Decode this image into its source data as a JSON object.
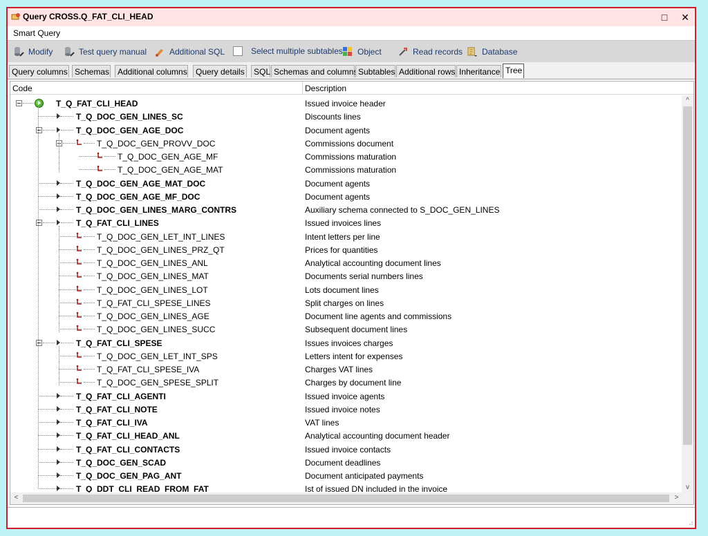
{
  "window": {
    "title": "Query CROSS.Q_FAT_CLI_HEAD",
    "maximize_icon": "□",
    "close_icon": "✕"
  },
  "menu": {
    "smart_query": "Smart Query"
  },
  "toolbar": {
    "modify": "Modify",
    "test_query_manual": "Test query manual",
    "additional_sql": "Additional SQL",
    "select_multiple_subtables": "Select multiple subtables",
    "object": "Object",
    "read_records": "Read records",
    "database": "Database"
  },
  "tabs": [
    {
      "label": "Query columns"
    },
    {
      "label": "Schemas"
    },
    {
      "label": "Additional columns"
    },
    {
      "label": "Query details"
    },
    {
      "label": "SQL"
    },
    {
      "label": "Schemas and columns"
    },
    {
      "label": "Subtables"
    },
    {
      "label": "Additional rows"
    },
    {
      "label": "Inheritance"
    },
    {
      "label": "Tree"
    }
  ],
  "grid": {
    "col_code": "Code",
    "col_description": "Description",
    "rows": [
      {
        "code": "T_Q_FAT_CLI_HEAD",
        "desc": "Issued invoice header",
        "level": 0,
        "bold": true,
        "kind": "root",
        "expanded": true
      },
      {
        "code": "T_Q_DOC_GEN_LINES_SC",
        "desc": "Discounts lines",
        "level": 1,
        "bold": true,
        "kind": "arrow"
      },
      {
        "code": "T_Q_DOC_GEN_AGE_DOC",
        "desc": "Document agents",
        "level": 1,
        "bold": true,
        "kind": "arrow",
        "expanded": true
      },
      {
        "code": "T_Q_DOC_GEN_PROVV_DOC",
        "desc": "Commissions document",
        "level": 2,
        "bold": false,
        "kind": "rel",
        "expanded": true
      },
      {
        "code": "T_Q_DOC_GEN_AGE_MF",
        "desc": "Commissions maturation",
        "level": 3,
        "bold": false,
        "kind": "rel"
      },
      {
        "code": "T_Q_DOC_GEN_AGE_MAT",
        "desc": "Commissions maturation",
        "level": 3,
        "bold": false,
        "kind": "rel"
      },
      {
        "code": "T_Q_DOC_GEN_AGE_MAT_DOC",
        "desc": "Document agents",
        "level": 1,
        "bold": true,
        "kind": "arrow"
      },
      {
        "code": "T_Q_DOC_GEN_AGE_MF_DOC",
        "desc": "Document agents",
        "level": 1,
        "bold": true,
        "kind": "arrow"
      },
      {
        "code": "T_Q_DOC_GEN_LINES_MARG_CONTRS",
        "desc": "Auxiliary schema connected to S_DOC_GEN_LINES",
        "level": 1,
        "bold": true,
        "kind": "arrow"
      },
      {
        "code": "T_Q_FAT_CLI_LINES",
        "desc": "Issued invoices lines",
        "level": 1,
        "bold": true,
        "kind": "arrow",
        "expanded": true
      },
      {
        "code": "T_Q_DOC_GEN_LET_INT_LINES",
        "desc": "Intent letters per line",
        "level": 2,
        "bold": false,
        "kind": "rel"
      },
      {
        "code": "T_Q_DOC_GEN_LINES_PRZ_QT",
        "desc": "Prices for quantities",
        "level": 2,
        "bold": false,
        "kind": "rel"
      },
      {
        "code": "T_Q_DOC_GEN_LINES_ANL",
        "desc": "Analytical accounting document lines",
        "level": 2,
        "bold": false,
        "kind": "rel"
      },
      {
        "code": "T_Q_DOC_GEN_LINES_MAT",
        "desc": "Documents serial numbers lines",
        "level": 2,
        "bold": false,
        "kind": "rel"
      },
      {
        "code": "T_Q_DOC_GEN_LINES_LOT",
        "desc": "Lots document lines",
        "level": 2,
        "bold": false,
        "kind": "rel"
      },
      {
        "code": "T_Q_FAT_CLI_SPESE_LINES",
        "desc": "Split charges on lines",
        "level": 2,
        "bold": false,
        "kind": "rel"
      },
      {
        "code": "T_Q_DOC_GEN_LINES_AGE",
        "desc": "Document line agents and commissions",
        "level": 2,
        "bold": false,
        "kind": "rel"
      },
      {
        "code": "T_Q_DOC_GEN_LINES_SUCC",
        "desc": "Subsequent document lines",
        "level": 2,
        "bold": false,
        "kind": "rel"
      },
      {
        "code": "T_Q_FAT_CLI_SPESE",
        "desc": "Issues invoices charges",
        "level": 1,
        "bold": true,
        "kind": "arrow",
        "expanded": true
      },
      {
        "code": "T_Q_DOC_GEN_LET_INT_SPS",
        "desc": "Letters intent for expenses",
        "level": 2,
        "bold": false,
        "kind": "rel"
      },
      {
        "code": "T_Q_FAT_CLI_SPESE_IVA",
        "desc": "Charges VAT lines",
        "level": 2,
        "bold": false,
        "kind": "rel"
      },
      {
        "code": "T_Q_DOC_GEN_SPESE_SPLIT",
        "desc": "Charges by document line",
        "level": 2,
        "bold": false,
        "kind": "rel"
      },
      {
        "code": "T_Q_FAT_CLI_AGENTI",
        "desc": "Issued invoice agents",
        "level": 1,
        "bold": true,
        "kind": "arrow"
      },
      {
        "code": "T_Q_FAT_CLI_NOTE",
        "desc": "Issued invoice notes",
        "level": 1,
        "bold": true,
        "kind": "arrow"
      },
      {
        "code": "T_Q_FAT_CLI_IVA",
        "desc": "VAT lines",
        "level": 1,
        "bold": true,
        "kind": "arrow"
      },
      {
        "code": "T_Q_FAT_CLI_HEAD_ANL",
        "desc": "Analytical accounting document header",
        "level": 1,
        "bold": true,
        "kind": "arrow"
      },
      {
        "code": "T_Q_FAT_CLI_CONTACTS",
        "desc": "Issued invoice contacts",
        "level": 1,
        "bold": true,
        "kind": "arrow"
      },
      {
        "code": "T_Q_DOC_GEN_SCAD",
        "desc": "Document deadlines",
        "level": 1,
        "bold": true,
        "kind": "arrow"
      },
      {
        "code": "T_Q_DOC_GEN_PAG_ANT",
        "desc": "Document anticipated payments",
        "level": 1,
        "bold": true,
        "kind": "arrow"
      },
      {
        "code": "T_Q_DDT_CLI_READ_FROM_FAT",
        "desc": "Ist of issued DN included in the invoice",
        "level": 1,
        "bold": true,
        "kind": "arrow"
      }
    ]
  },
  "scroll": {
    "up": "^",
    "down": "v",
    "left": "<",
    "right": ">"
  }
}
